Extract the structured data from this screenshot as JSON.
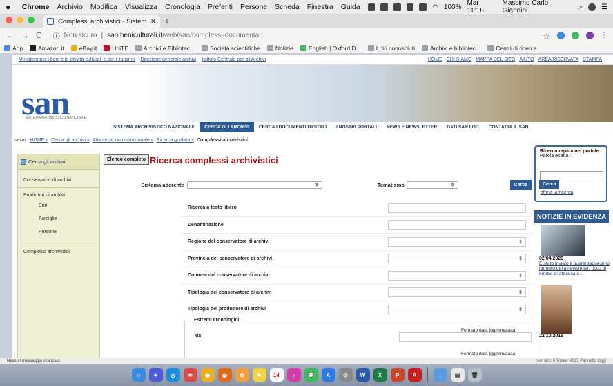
{
  "menubar": {
    "app": "Chrome",
    "items": [
      "Archivio",
      "Modifica",
      "Visualizza",
      "Cronologia",
      "Preferiti",
      "Persone",
      "Scheda",
      "Finestra",
      "Guida"
    ],
    "battery": "100%",
    "clock": "Mar 11:18",
    "user": "Massimo Carlo Giannini"
  },
  "tab": {
    "title": "Complessi archivistici - Sistem"
  },
  "address": {
    "security": "Non sicuro",
    "domain": "san.beniculturali.it",
    "path": "/web/san/complessi-documentari"
  },
  "bookmarks": [
    "App",
    "Amazon.it",
    "eBay.it",
    "UniTE",
    "Archivi e Bibliotec...",
    "Società scientifiche",
    "Notizie",
    "English | Oxford D...",
    "I più conosciuti",
    "Archivi e bibliotec...",
    "Centri di ricerca"
  ],
  "toplinks": {
    "left": [
      "Ministero per i beni e le attività culturali e per il turismo",
      "Direzione generale archivi",
      "Istituto Centrale per gli Archivi"
    ],
    "right": [
      "HOME",
      "CHI SIAMO",
      "MAPPA DEL SITO",
      "AIUTO",
      "AREA RISERVATA",
      "STAMPA"
    ]
  },
  "logo": {
    "text": "san",
    "subtitle": "SISTEMA ARCHIVISTICO NAZIONALE"
  },
  "nav": [
    "SISTEMA ARCHIVISTICO NAZIONALE",
    "CERCA GLI ARCHIVI",
    "CERCA I DOCUMENTI DIGITALI",
    "I NOSTRI PORTALI",
    "NEWS E NEWSLETTER",
    "DATI SAN LOD",
    "CONTATTA IL SAN"
  ],
  "crumbs": {
    "prefix": "sei in:",
    "items": [
      "HOME »",
      "Cerca gli archivi »",
      "Atlante storico istituzionale »",
      "Ricerca guidata »"
    ],
    "current": "Complessi archivistici"
  },
  "sidebar": {
    "head": "Cerca gli archivi",
    "items": [
      "Conservatori di archivi",
      "Produttori di archivi",
      "Enti",
      "Famiglie",
      "Persone",
      "Complessi archivistici"
    ]
  },
  "main": {
    "elenco": "Elenco completo",
    "title": "Ricerca complessi archivistici",
    "sistema": "Sistema aderente",
    "tematismo": "Tematismo",
    "cerca": "Cerca",
    "fields": [
      "Ricerca a testo libero",
      "Denominazione",
      "Regione del conservatore di archivi",
      "Provincia del conservatore di archivi",
      "Comune del conservatore di archivi",
      "Tipologia del conservatore di archivi",
      "Tipologia del produttore di archivi"
    ],
    "fieldset": {
      "legend": "Estremi cronologici",
      "format": "Formato data [gg/mm/aaaa]",
      "da": "da"
    }
  },
  "quick": {
    "title": "Ricerca rapida nel portale",
    "label": "Parola esatta :",
    "cerca": "Cerca",
    "affina": "affina la ricerca"
  },
  "news": {
    "header": "NOTIZIE IN EVIDENZA",
    "date1": "02/04/2020",
    "text1": "È stato inviato il quarantaduesimo numero della newsletter, ricco di notizie di attualità e...",
    "date2": "22/10/2019"
  },
  "status": {
    "left": "Nessun messaggio scaricato",
    "right": "Non letti: 0  Totale: 4325  Pannello Oggi"
  },
  "colors": {
    "accent": "#2e5b95",
    "title_red": "#b5121b",
    "sidebar_bg": "#eef0d4"
  }
}
